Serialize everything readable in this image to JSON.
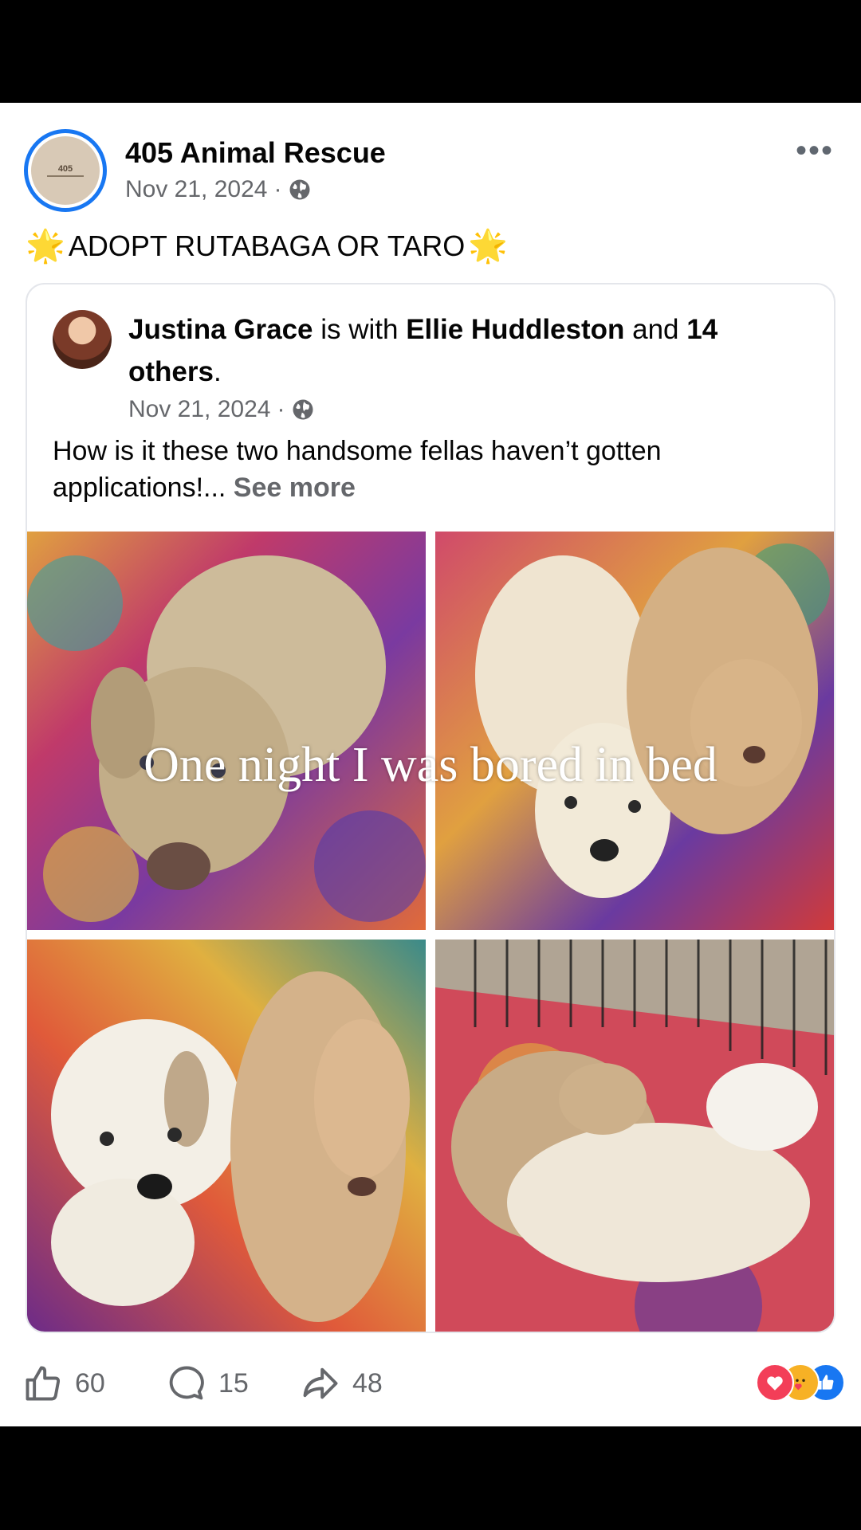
{
  "post": {
    "page_name": "405 Animal Rescue",
    "date": "Nov 21, 2024",
    "dot": "·",
    "avatar_logo_text": "405",
    "text": "ADOPT RUTABAGA OR TARO",
    "more": "•••"
  },
  "shared": {
    "author": "Justina Grace",
    "is_with": " is with ",
    "tagged": "Ellie Huddleston",
    "and": " and ",
    "others_bold": "14 others",
    "period": ".",
    "date": "Nov 21, 2024",
    "body": "How is it these two handsome fellas haven’t gotten applications!... ",
    "see_more": "See more"
  },
  "caption": "One night I was bored in bed",
  "actions": {
    "likes": "60",
    "comments": "15",
    "shares": "48"
  },
  "icons": {
    "globe": "globe-icon",
    "more": "more-icon",
    "like": "thumbs-up-icon",
    "comment": "comment-icon",
    "share": "share-icon",
    "sparkle": "sparkle-icon"
  },
  "colors": {
    "accent": "#1877f2",
    "secondary_text": "#65676b",
    "love": "#f33e58",
    "care": "#f7b125"
  }
}
